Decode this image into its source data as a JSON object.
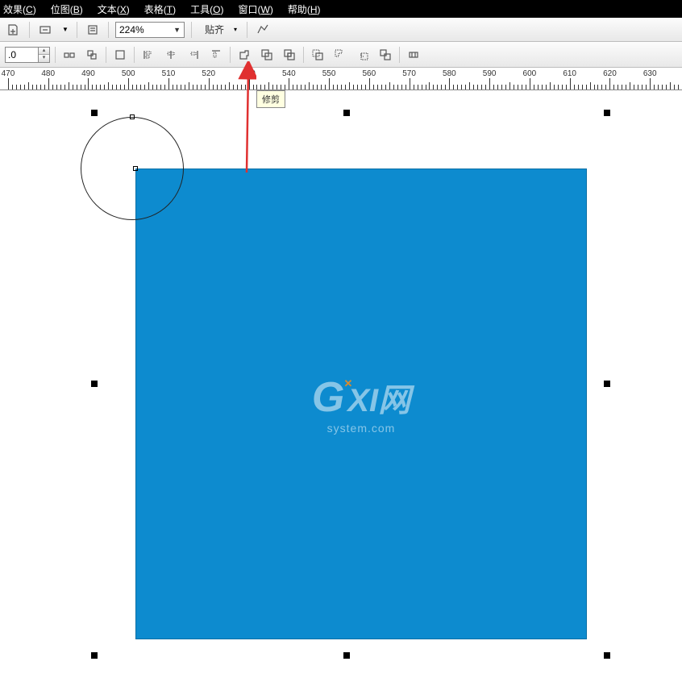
{
  "menubar": {
    "items": [
      {
        "label": "效果",
        "key": "C"
      },
      {
        "label": "位图",
        "key": "B"
      },
      {
        "label": "文本",
        "key": "X"
      },
      {
        "label": "表格",
        "key": "T"
      },
      {
        "label": "工具",
        "key": "O"
      },
      {
        "label": "窗口",
        "key": "W"
      },
      {
        "label": "帮助",
        "key": "H"
      }
    ]
  },
  "toolbar1": {
    "zoom": "224%",
    "snap_label": "贴齐"
  },
  "toolbar2": {
    "num_value": ".0"
  },
  "ruler": {
    "start": 470,
    "end": 630,
    "step": 10
  },
  "tooltip": "修剪",
  "watermark": {
    "big_g": "G",
    "big_rest": "XI网",
    "small": "system.com"
  },
  "canvas": {
    "center_mark": "✕"
  }
}
